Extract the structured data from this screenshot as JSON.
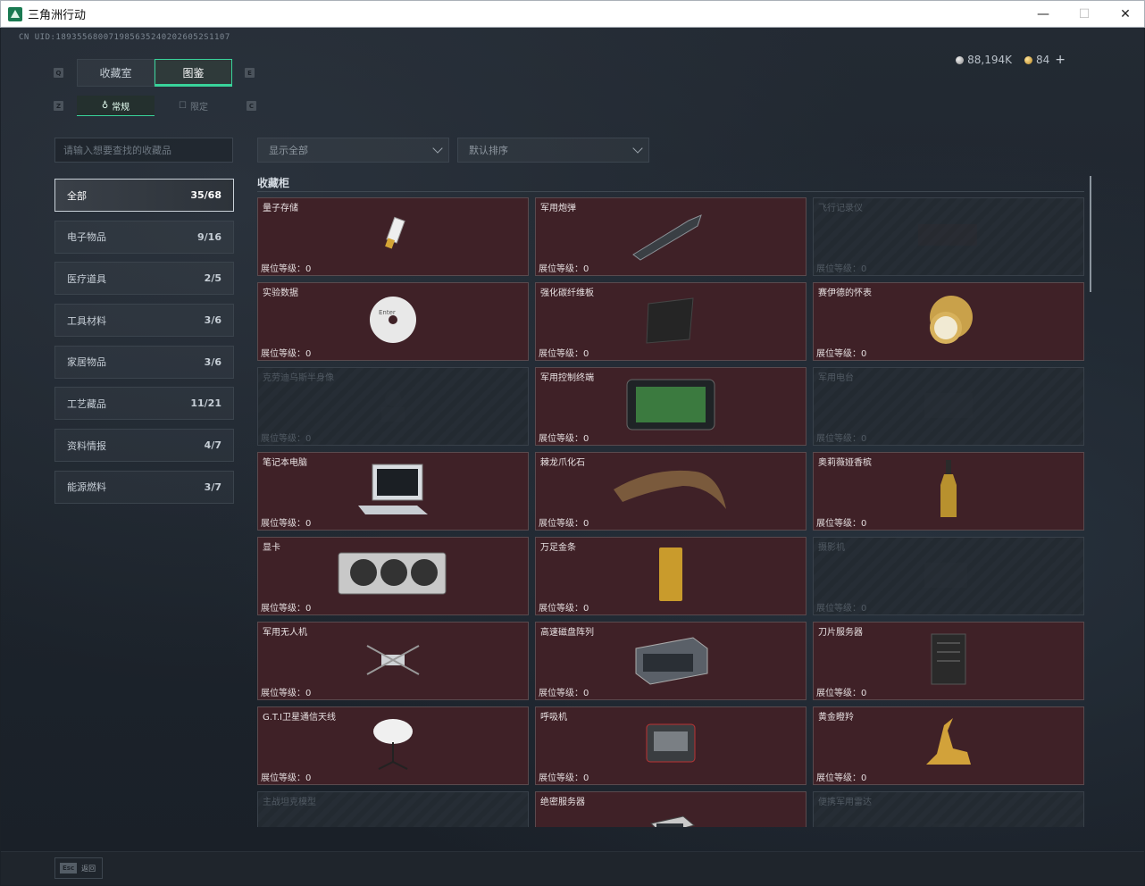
{
  "window": {
    "title": "三角洲行动",
    "minimize": "—",
    "maximize": "☐",
    "close": "✕"
  },
  "uid": "CN UID:1893556800719856352402026052S1107",
  "currency": {
    "silver": "88,194K",
    "gold": "84",
    "plus": "+"
  },
  "tabs": {
    "prev_key": "Q",
    "next_key": "E",
    "main": [
      {
        "label": "收藏室"
      },
      {
        "label": "图鉴"
      }
    ],
    "sub_prev_key": "Z",
    "sub_next_key": "C",
    "sub": [
      {
        "label": "常规"
      },
      {
        "label": "限定"
      }
    ]
  },
  "search": {
    "placeholder": "请输入想要查找的收藏品"
  },
  "filters": {
    "show": "显示全部",
    "sort": "默认排序"
  },
  "categories": [
    {
      "label": "全部",
      "count": "35/68"
    },
    {
      "label": "电子物品",
      "count": "9/16"
    },
    {
      "label": "医疗道具",
      "count": "2/5"
    },
    {
      "label": "工具材料",
      "count": "3/6"
    },
    {
      "label": "家居物品",
      "count": "3/6"
    },
    {
      "label": "工艺藏品",
      "count": "11/21"
    },
    {
      "label": "资料情报",
      "count": "4/7"
    },
    {
      "label": "能源燃料",
      "count": "3/7"
    }
  ],
  "section": {
    "title": "收藏柜"
  },
  "items": [
    {
      "name": "量子存储",
      "level": "展位等级：0",
      "locked": false,
      "icon": "usb-drive-icon"
    },
    {
      "name": "军用炮弹",
      "level": "展位等级：0",
      "locked": false,
      "icon": "shell-icon"
    },
    {
      "name": "飞行记录仪",
      "level": "展位等级：0",
      "locked": true,
      "icon": "flight-recorder-icon"
    },
    {
      "name": "实验数据",
      "level": "展位等级：0",
      "locked": false,
      "icon": "disc-icon"
    },
    {
      "name": "强化碳纤维板",
      "level": "展位等级：0",
      "locked": false,
      "icon": "carbon-plate-icon"
    },
    {
      "name": "赛伊德的怀表",
      "level": "展位等级：0",
      "locked": false,
      "icon": "pocket-watch-icon"
    },
    {
      "name": "克劳迪乌斯半身像",
      "level": "展位等级：0",
      "locked": true,
      "icon": "bust-icon"
    },
    {
      "name": "军用控制终端",
      "level": "展位等级：0",
      "locked": false,
      "icon": "terminal-icon"
    },
    {
      "name": "军用电台",
      "level": "展位等级：0",
      "locked": true,
      "icon": "radio-icon"
    },
    {
      "name": "笔记本电脑",
      "level": "展位等级：0",
      "locked": false,
      "icon": "laptop-icon"
    },
    {
      "name": "棘龙爪化石",
      "level": "展位等级：0",
      "locked": false,
      "icon": "claw-fossil-icon"
    },
    {
      "name": "奥莉薇娅香槟",
      "level": "展位等级：0",
      "locked": false,
      "icon": "champagne-icon"
    },
    {
      "name": "显卡",
      "level": "展位等级：0",
      "locked": false,
      "icon": "gpu-icon"
    },
    {
      "name": "万足金条",
      "level": "展位等级：0",
      "locked": false,
      "icon": "gold-bar-icon"
    },
    {
      "name": "摄影机",
      "level": "展位等级：0",
      "locked": true,
      "icon": "camera-icon"
    },
    {
      "name": "军用无人机",
      "level": "展位等级：0",
      "locked": false,
      "icon": "drone-icon"
    },
    {
      "name": "高速磁盘阵列",
      "level": "展位等级：0",
      "locked": false,
      "icon": "disk-array-icon"
    },
    {
      "name": "刀片服务器",
      "level": "展位等级：0",
      "locked": false,
      "icon": "blade-server-icon"
    },
    {
      "name": "G.T.I卫星通信天线",
      "level": "展位等级：0",
      "locked": false,
      "icon": "satellite-dish-icon"
    },
    {
      "name": "呼吸机",
      "level": "展位等级：0",
      "locked": false,
      "icon": "ventilator-icon"
    },
    {
      "name": "黄金瞪羚",
      "level": "展位等级：0",
      "locked": false,
      "icon": "gold-gazelle-icon"
    },
    {
      "name": "主战坦克模型",
      "level": "",
      "locked": true,
      "icon": "tank-model-icon"
    },
    {
      "name": "绝密服务器",
      "level": "",
      "locked": false,
      "icon": "server-icon"
    },
    {
      "name": "便携军用雷达",
      "level": "",
      "locked": true,
      "icon": "radar-icon"
    }
  ],
  "bottom": {
    "esc_key": "Esc",
    "esc_label": "返回"
  }
}
